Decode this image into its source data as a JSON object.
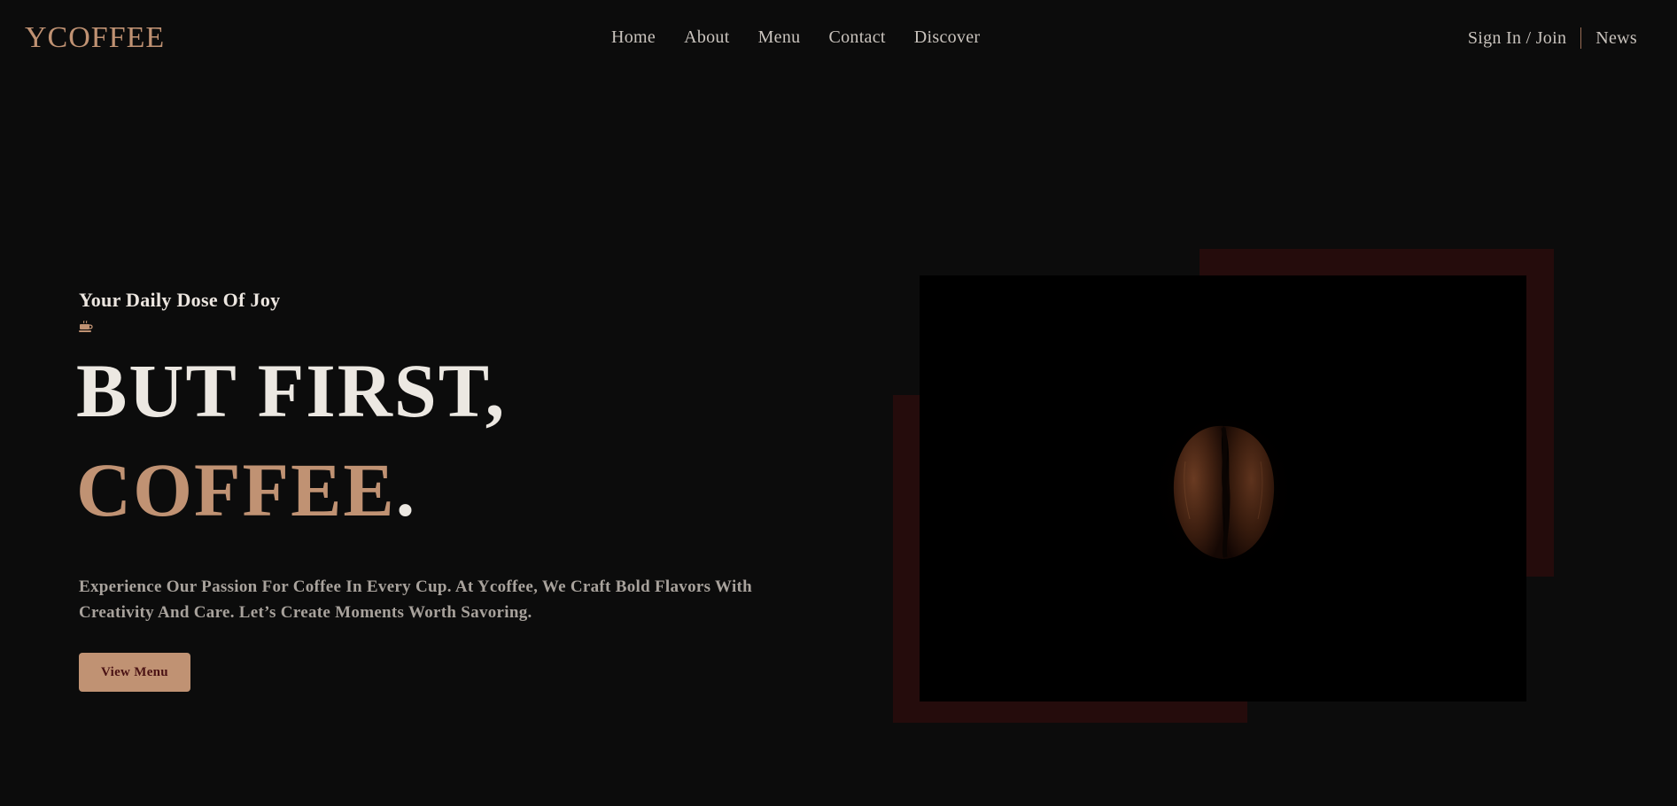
{
  "brand": {
    "logo": "YCOFFEE"
  },
  "nav": {
    "items": [
      "Home",
      "About",
      "Menu",
      "Contact",
      "Discover"
    ],
    "signin": "Sign In / Join",
    "news": "News"
  },
  "hero": {
    "tagline": "Your Daily Dose Of Joy",
    "icon": "coffee-cup-icon",
    "headline_line1": "BUT FIRST,",
    "headline_line2": "COFFEE",
    "headline_dot": ".",
    "description": "Experience Our Passion For Coffee In Every Cup. At Ycoffee, We Craft Bold Flavors With Creativity And Care. Let’s Create Moments Worth Savoring.",
    "cta_label": "View Menu",
    "image": "coffee-bean-image"
  },
  "colors": {
    "background": "#0c0c0c",
    "accent": "#c09273",
    "accent_block": "#250c0c",
    "text_light": "#ece8e2",
    "button_text": "#4a1214"
  }
}
